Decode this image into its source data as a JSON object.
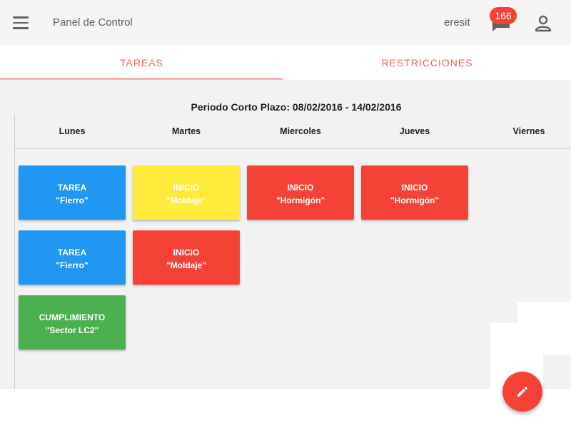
{
  "header": {
    "title": "Panel de Control",
    "user": "eresit",
    "notifications": "166"
  },
  "tabs": [
    {
      "label": "TAREAS",
      "active": true
    },
    {
      "label": "RESTRICCIONES",
      "active": false
    }
  ],
  "period": "Periodo Corto Plazo: 08/02/2016 - 14/02/2016",
  "days": [
    "Lunes",
    "Martes",
    "Miercoles",
    "Jueves",
    "Viernes"
  ],
  "cards": [
    {
      "line1": "TAREA",
      "line2": "\"Fierro\"",
      "color": "#2196f3"
    },
    {
      "line1": "INICIO",
      "line2": "\"Moldaje\"",
      "color": "#ffeb3b"
    },
    {
      "line1": "INICIO",
      "line2": "\"Hormigón\"",
      "color": "#f44336"
    },
    {
      "line1": "INICIO",
      "line2": "\"Hormigón\"",
      "color": "#f44336"
    },
    {
      "line1": "TAREA",
      "line2": "\"Fierro\"",
      "color": "#2196f3"
    },
    {
      "line1": "INICIO",
      "line2": "\"Moldaje\"",
      "color": "#f44336"
    },
    {
      "line1": "CUMPLIMIENTO",
      "line2": "\"Sector LC2\"",
      "color": "#4caf50"
    }
  ],
  "colors": {
    "accent": "#f06262",
    "fab": "#f44336"
  },
  "fab_icon": "pencil-icon"
}
